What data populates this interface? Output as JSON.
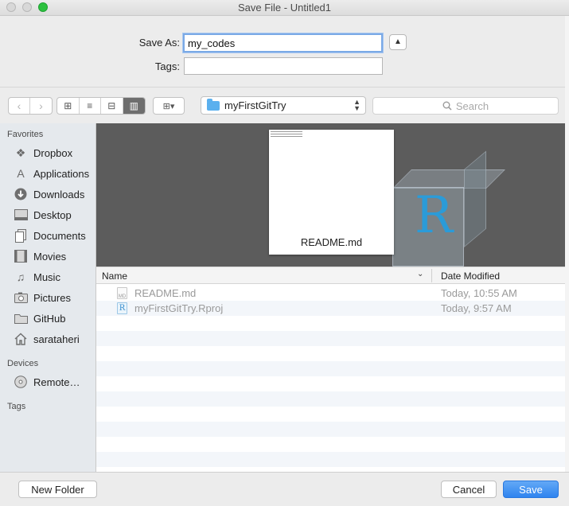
{
  "window": {
    "title": "Save File - Untitled1"
  },
  "save_form": {
    "save_as_label": "Save As:",
    "save_as_value": "my_codes",
    "tags_label": "Tags:",
    "tags_value": "",
    "expand_icon": "chevron-up-icon"
  },
  "toolbar": {
    "back_icon": "‹",
    "forward_icon": "›",
    "view_icons": [
      "⊞",
      "≡",
      "⊟",
      "▥"
    ],
    "arrange_icon": "⊞▾",
    "location": "myFirstGitTry",
    "search_placeholder": "Search"
  },
  "sidebar": {
    "favorites_label": "Favorites",
    "favorites": [
      {
        "label": "Dropbox",
        "icon": "dropbox-icon"
      },
      {
        "label": "Applications",
        "icon": "applications-icon"
      },
      {
        "label": "Downloads",
        "icon": "downloads-icon"
      },
      {
        "label": "Desktop",
        "icon": "desktop-icon"
      },
      {
        "label": "Documents",
        "icon": "documents-icon"
      },
      {
        "label": "Movies",
        "icon": "movies-icon"
      },
      {
        "label": "Music",
        "icon": "music-icon"
      },
      {
        "label": "Pictures",
        "icon": "pictures-icon"
      },
      {
        "label": "GitHub",
        "icon": "folder-icon"
      },
      {
        "label": "sarataheri",
        "icon": "home-icon"
      }
    ],
    "devices_label": "Devices",
    "devices": [
      {
        "label": "Remote…",
        "icon": "disc-icon"
      }
    ],
    "tags_label": "Tags"
  },
  "preview": {
    "file_name": "README.md",
    "logo_letter": "R"
  },
  "file_list": {
    "columns": {
      "name": "Name",
      "date_modified": "Date Modified"
    },
    "rows": [
      {
        "name": "README.md",
        "date": "Today, 10:55 AM",
        "icon_text": "MD"
      },
      {
        "name": "myFirstGitTry.Rproj",
        "date": "Today, 9:57 AM",
        "icon_text": "R"
      }
    ]
  },
  "buttons": {
    "new_folder": "New Folder",
    "cancel": "Cancel",
    "save": "Save"
  },
  "colors": {
    "accent": "#2f84ef",
    "folder": "#5bb0ee",
    "r_logo": "#2b9bd8"
  }
}
